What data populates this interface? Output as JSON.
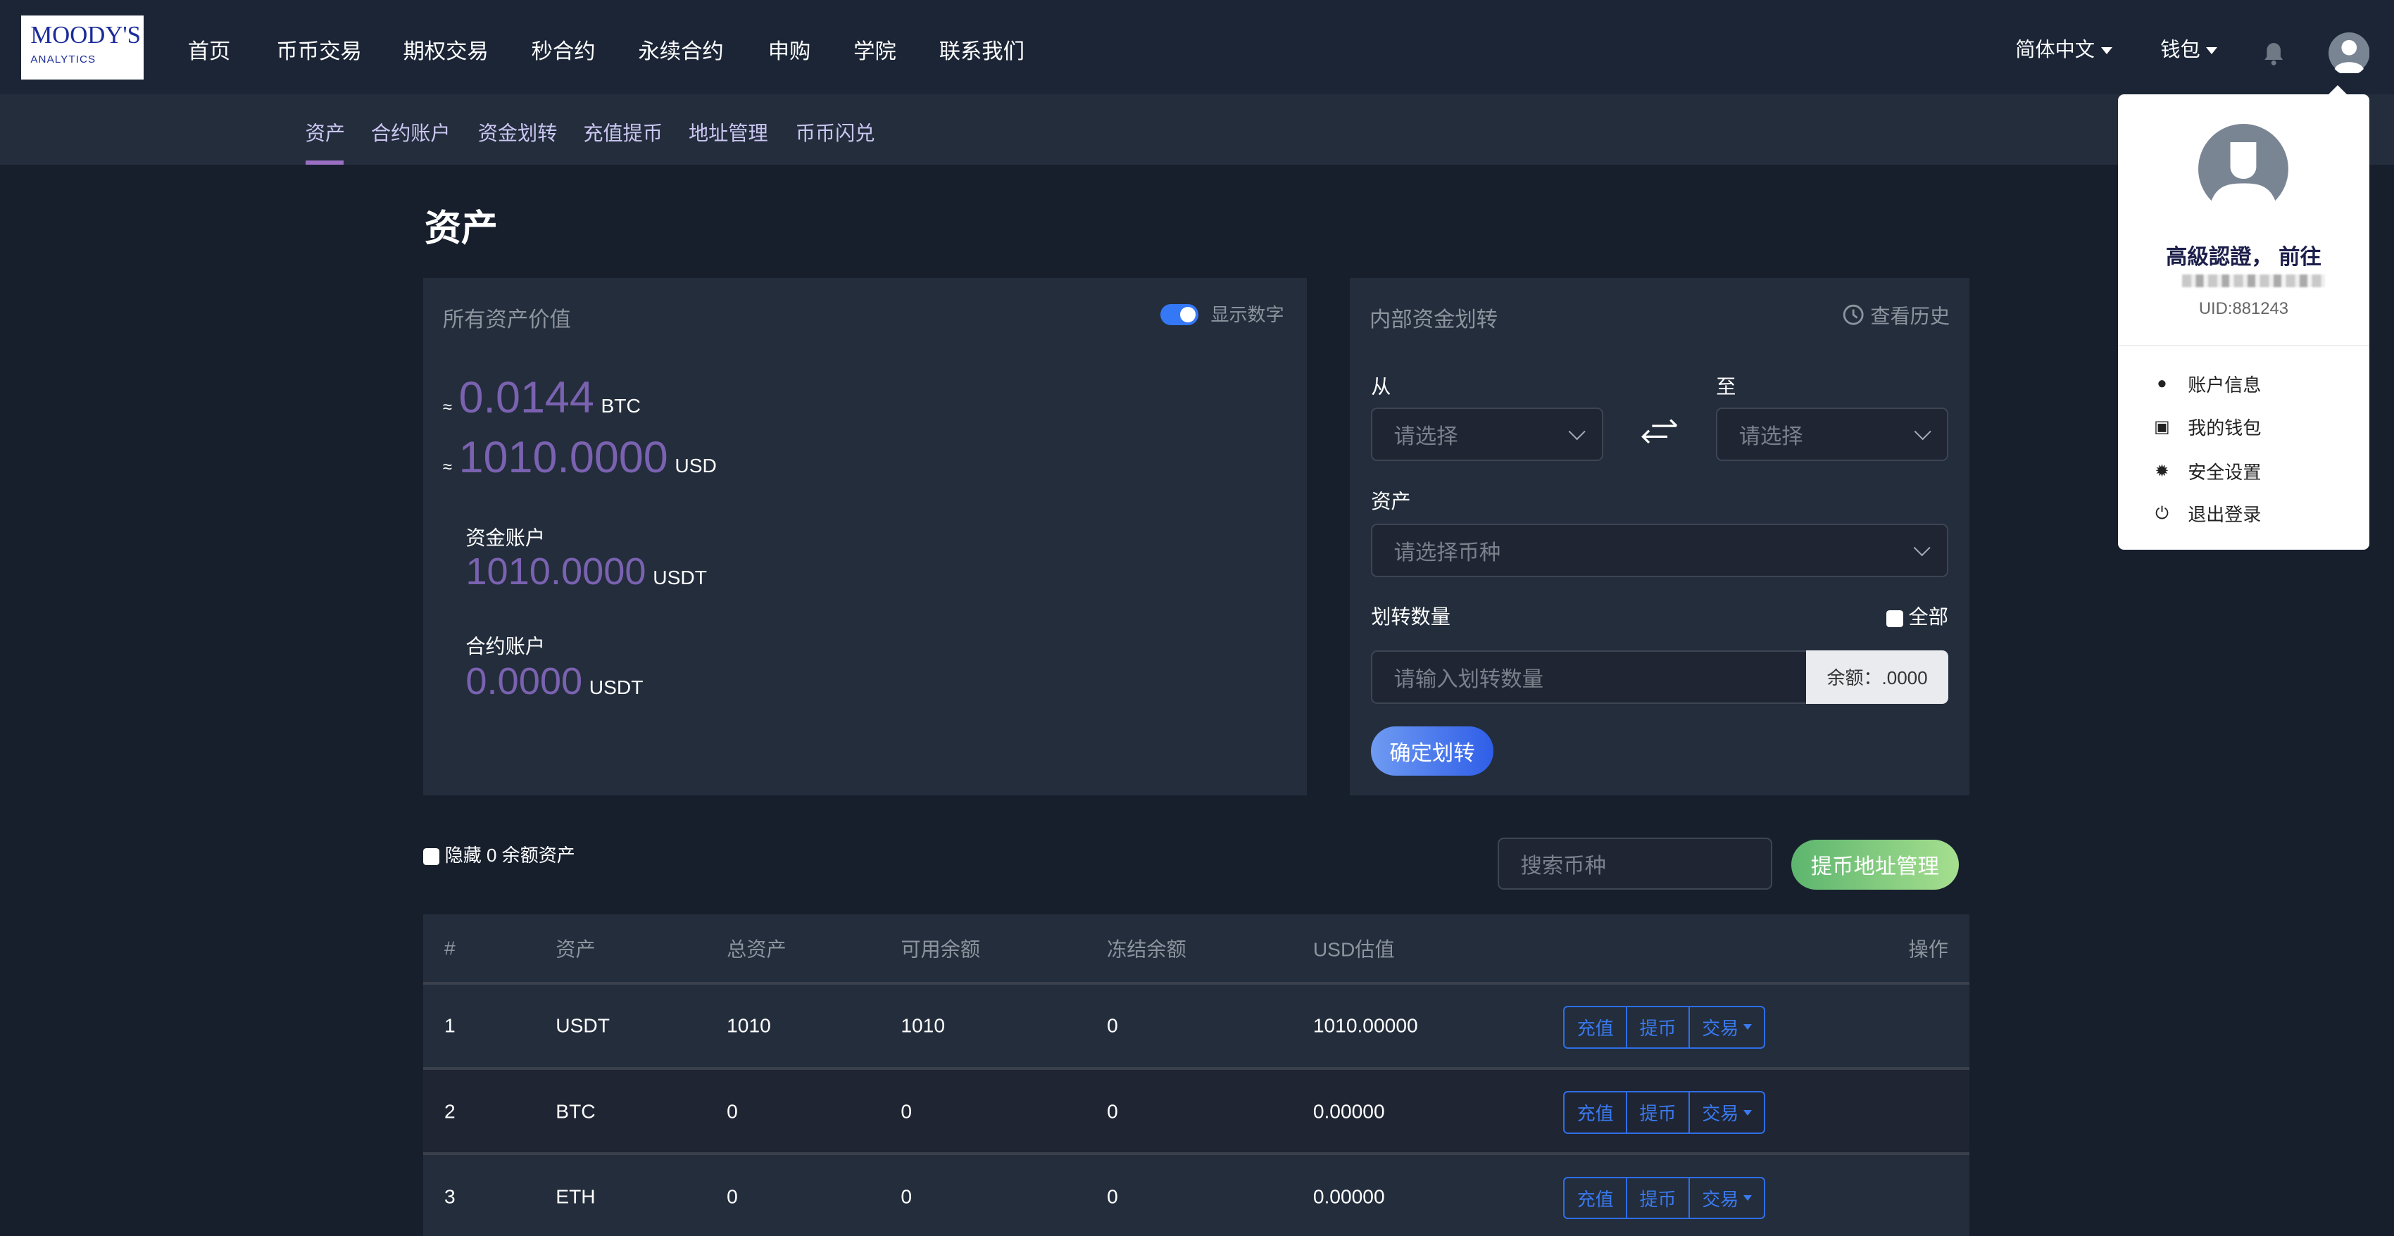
{
  "brand": {
    "logo_line1": "MOODY'S",
    "logo_line2": "ANALYTICS"
  },
  "nav": {
    "items": [
      "首页",
      "币币交易",
      "期权交易",
      "秒合约",
      "永续合约",
      "申购",
      "学院",
      "联系我们"
    ],
    "language": "简体中文",
    "wallet": "钱包"
  },
  "subnav": {
    "items": [
      "资产",
      "合约账户",
      "资金划转",
      "充值提币",
      "地址管理",
      "币币闪兑"
    ],
    "active": "资产"
  },
  "page": {
    "title": "资产"
  },
  "summary": {
    "title": "所有资产价值",
    "toggle_label": "显示数字",
    "toggle_on": true,
    "approx": "≈",
    "btc_value": "0.0144",
    "btc_unit": "BTC",
    "usd_value": "1010.0000",
    "usd_unit": "USD",
    "fund_label": "资金账户",
    "fund_value": "1010.0000",
    "fund_unit": "USDT",
    "contract_label": "合约账户",
    "contract_value": "0.0000",
    "contract_unit": "USDT"
  },
  "transfer": {
    "title": "内部资金划转",
    "history": "查看历史",
    "from_label": "从",
    "to_label": "至",
    "from_placeholder": "请选择",
    "to_placeholder": "请选择",
    "asset_label": "资产",
    "asset_placeholder": "请选择币种",
    "amount_label": "划转数量",
    "all_label": "全部",
    "amount_placeholder": "请输入划转数量",
    "balance": "余额：.0000",
    "submit": "确定划转"
  },
  "filters": {
    "hide_zero": "隐藏 0 余额资产",
    "search_placeholder": "搜索币种",
    "address_button": "提币地址管理"
  },
  "table": {
    "headers": [
      "#",
      "资产",
      "总资产",
      "可用余额",
      "冻结余额",
      "USD估值",
      "操作"
    ],
    "rows": [
      [
        "1",
        "USDT",
        "1010",
        "1010",
        "0",
        "1010.00000"
      ],
      [
        "2",
        "BTC",
        "0",
        "0",
        "0",
        "0.00000"
      ],
      [
        "3",
        "ETH",
        "0",
        "0",
        "0",
        "0.00000"
      ]
    ],
    "actions": [
      "充值",
      "提币",
      "交易"
    ]
  },
  "user_menu": {
    "title": "高級認證， 前往",
    "uid": "UID:881243",
    "items": [
      {
        "icon": "user-icon",
        "label": "账户信息"
      },
      {
        "icon": "wallet-icon",
        "label": "我的钱包"
      },
      {
        "icon": "gear-icon",
        "label": "安全设置"
      },
      {
        "icon": "power-icon",
        "label": "退出登录"
      }
    ]
  },
  "colors": {
    "accent_purple": "#7a62b0",
    "link_blue": "#2f6ee8",
    "green": "#6cc57a"
  }
}
